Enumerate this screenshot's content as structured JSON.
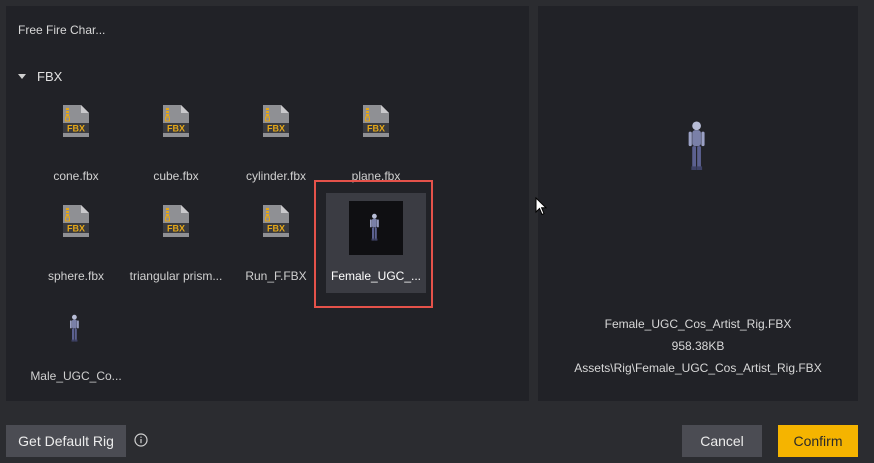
{
  "breadcrumb": "Free Fire Char...",
  "folder": {
    "label": "FBX",
    "expanded": true
  },
  "files": [
    {
      "label": "cone.fbx",
      "icon": "fbx-file-icon"
    },
    {
      "label": "cube.fbx",
      "icon": "fbx-file-icon"
    },
    {
      "label": "cylinder.fbx",
      "icon": "fbx-file-icon"
    },
    {
      "label": "plane.fbx",
      "icon": "fbx-file-icon"
    },
    {
      "label": "sphere.fbx",
      "icon": "fbx-file-icon"
    },
    {
      "label": "triangular prism...",
      "icon": "fbx-file-icon"
    },
    {
      "label": "Run_F.FBX",
      "icon": "fbx-file-icon"
    },
    {
      "label": "Female_UGC_...",
      "icon": "character-model-thumbnail",
      "selected": true
    },
    {
      "label": "Male_UGC_Co...",
      "icon": "character-model-thumbnail"
    }
  ],
  "preview": {
    "name": "Female_UGC_Cos_Artist_Rig.FBX",
    "size": "958.38KB",
    "path": "Assets\\Rig\\Female_UGC_Cos_Artist_Rig.FBX"
  },
  "footer": {
    "default_rig_label": "Get Default Rig",
    "cancel_label": "Cancel",
    "confirm_label": "Confirm"
  },
  "colors": {
    "accent": "#f5b400",
    "selection_outline": "#e5524a",
    "fbx_badge": "#e6a817"
  }
}
